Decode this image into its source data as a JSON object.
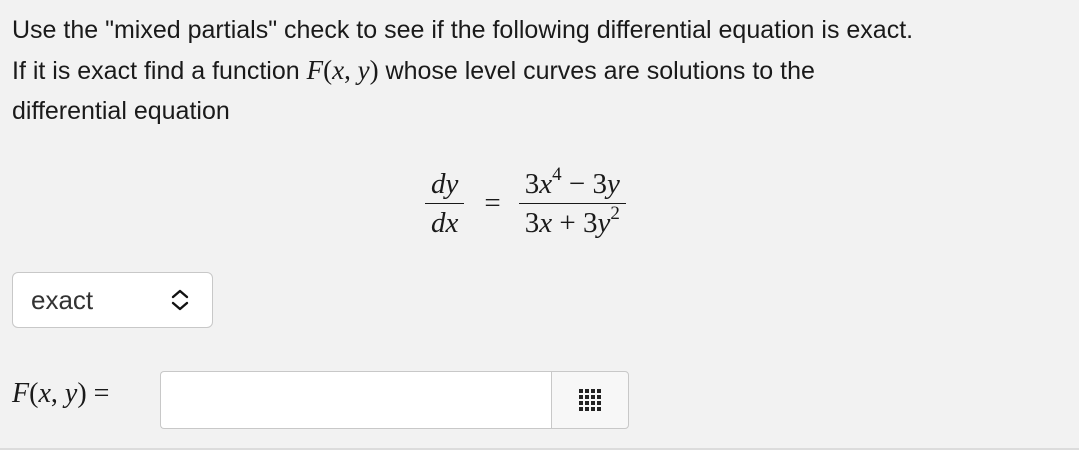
{
  "problem": {
    "line1": "Use the \"mixed partials\" check to see if the following differential equation is exact.",
    "line2_before": "If it is exact find a function ",
    "line2_after": " whose level curves are solutions to the",
    "line3": "differential equation"
  },
  "equation": {
    "lhs_num": "dy",
    "lhs_den": "dx",
    "equals": "=",
    "rhs_num_a": "3",
    "rhs_num_b": "x",
    "rhs_num_exp": "4",
    "rhs_num_c": " − 3",
    "rhs_num_d": "y",
    "rhs_den_a": "3",
    "rhs_den_b": "x",
    "rhs_den_c": " + 3",
    "rhs_den_d": "y",
    "rhs_den_exp": "2"
  },
  "function_notation": {
    "name": "F",
    "open": "(",
    "x": "x",
    "comma": ", ",
    "y": "y",
    "close": ")"
  },
  "exactness_select": {
    "selected": "exact",
    "icon": "up-down-chevron-icon"
  },
  "answer": {
    "equals": " =",
    "value": "",
    "palette_icon": "grid-icon"
  }
}
